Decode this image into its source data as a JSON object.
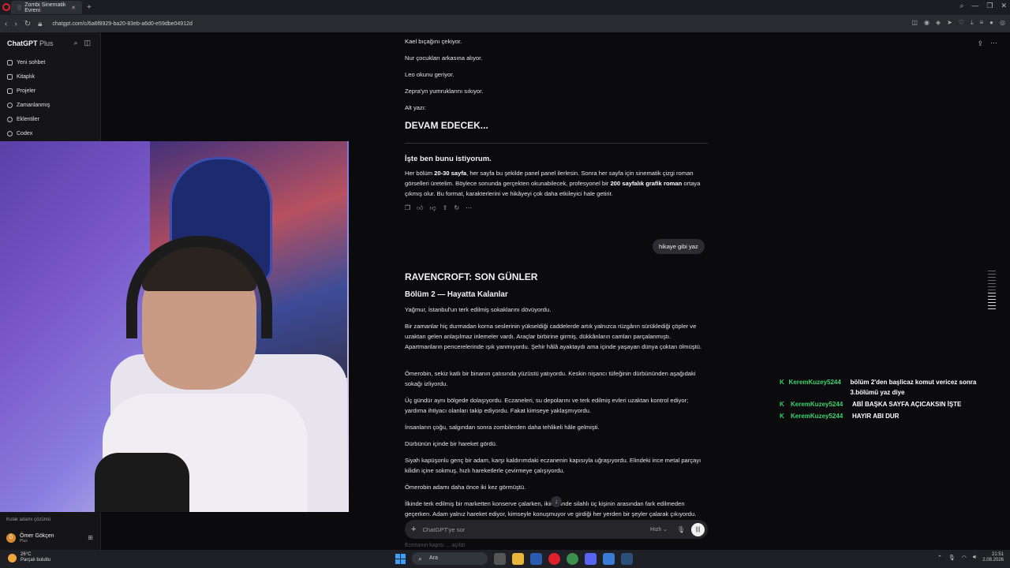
{
  "browser": {
    "tab_title": "Zombi Sinematik Evreni",
    "url": "chatgpt.com/c/6a6f8929-ba20-83eb-a6d0-e59dbe04912d"
  },
  "sidebar": {
    "brand": "ChatGPT",
    "brand_suffix": "Plus",
    "items": [
      {
        "label": "Yeni sohbet"
      },
      {
        "label": "Kitaplık"
      },
      {
        "label": "Projeler"
      },
      {
        "label": "Zamanlanmış"
      },
      {
        "label": "Eklentiler"
      },
      {
        "label": "Codex"
      }
    ],
    "hidden_item": "Kulak adamı çözümü",
    "user": {
      "initial": "Ö",
      "name": "Ömer Gökçen",
      "plan": "Plus"
    }
  },
  "chat": {
    "lines_top": [
      "Kael bıçağını çekiyor.",
      "Nur çocukları arkasına alıyor.",
      "Leo okunu geriyor.",
      "Zepra'yn yumruklarını sıkıyor.",
      "Alt yazı:"
    ],
    "devam": "DEVAM EDECEK...",
    "isteben_title": "İşte ben bunu istiyorum.",
    "isteben_p1": "Her bölüm ",
    "isteben_b1": "20-30 sayfa",
    "isteben_p2": ", her sayfa bu şekilde panel panel ilerlesin. Sonra her sayfa için sinematik çizgi roman görselleri üretelim. Böylece sonunda gerçekten okunabilecek, profesyonel bir ",
    "isteben_b2": "200 sayfalık grafik roman",
    "isteben_p3": " ortaya çıkmış olur. Bu format, karakterlerini ve hikâyeyi çok daha etkileyici hale getirir.",
    "user_message": "hikaye gibi yaz",
    "story_title": "RAVENCROFT: SON GÜNLER",
    "chapter_title": "Bölüm 2 — Hayatta Kalanlar",
    "paragraphs": [
      "Yağmur, İstanbul'un terk edilmiş sokaklarını dövüyordu.",
      "Bir zamanlar hiç durmadan korna seslerinin yükseldiği caddelerde artık yalnızca rüzgârın sürüklediği çöpler ve uzaktan gelen anlaşılmaz inlemeler vardı. Araçlar birbirine girmiş, dükkânların camları parçalanmıştı. Apartmanların pencerelerinde ışık yanmıyordu. Şehir hâlâ ayaktaydı ama içinde yaşayan dünya çoktan ölmüştü.",
      "Ömerobin, sekiz katlı bir binanın çatısında yüzüstü yatıyordu. Keskin nişancı tüfeğinin dürbününden aşağıdaki sokağı izliyordu.",
      "Üç gündür aynı bölgede dolaşıyordu. Eczaneleri, su depolarını ve terk edilmiş evleri uzaktan kontrol ediyor; yardıma ihtiyacı olanları takip ediyordu. Fakat kimseye yaklaşmıyordu.",
      "İnsanların çoğu, salgından sonra zombilerden daha tehlikeli hâle gelmişti.",
      "Dürbünün içinde bir hareket gördü.",
      "Siyah kapüşonlu genç bir adam, karşı kaldırımdaki eczanenin kapısıyla uğraşıyordu. Elindeki ince metal parçayı kilidin içine sokmuş, hızlı hareketlerle çevirmeye çalışıyordu.",
      "Ömerobin adamı daha önce iki kez görmüştü.",
      "İlkinde terk edilmiş bir marketten konserve çalarken, ikincisinde silahlı üç kişinin arasından fark edilmeden geçerken. Adam yalnız hareket ediyor, kimseyle konuşmuyor ve girdiği her yerden bir şeyler çalarak çıkıyordu."
    ],
    "composer_placeholder": "ChatGPT'ye sor",
    "composer_speed": "Hızlı",
    "faded_text": "Ecezanın kapısı ... açıldı"
  },
  "stream_chat": [
    {
      "user": "KeremKuzey5244",
      "message": "bölüm 2'den başlicaz komut vericez sonra 3.bölümü yaz diye"
    },
    {
      "user": "KeremKuzey5244",
      "message": "ABİ BAŞKA SAYFA AÇICAKSIN İŞTE"
    },
    {
      "user": "KeremKuzey5244",
      "message": "HAYIR ABI DUR"
    }
  ],
  "taskbar": {
    "temp": "26°C",
    "weather": "Parçalı bulutlu",
    "search": "Ara",
    "time": "21:51",
    "date": "2.08.2026"
  },
  "colors": {
    "chat_user": "#36d36e",
    "accent_red": "#e0202a"
  }
}
